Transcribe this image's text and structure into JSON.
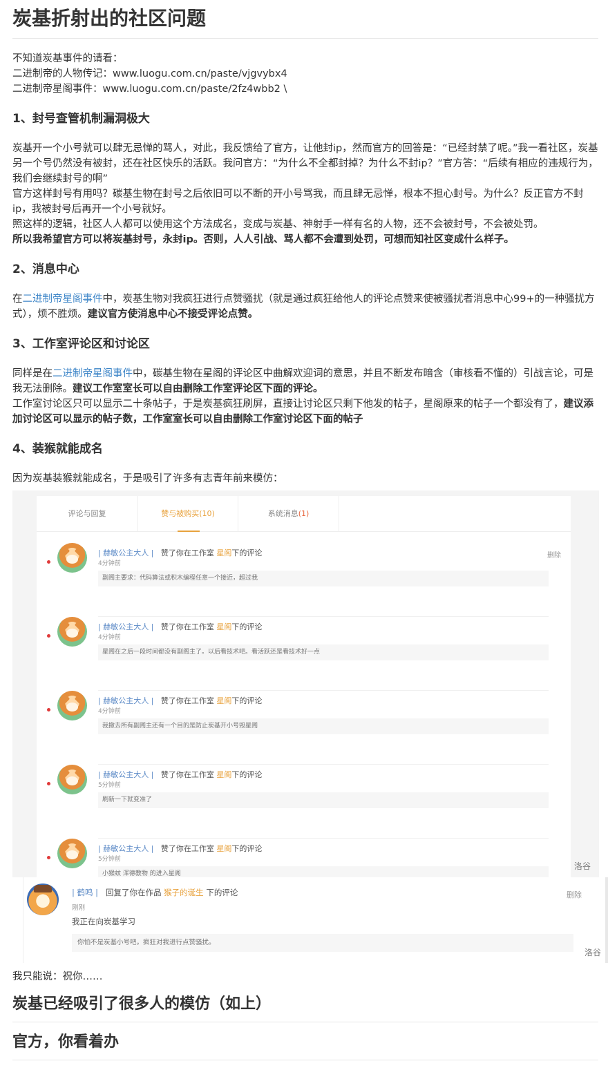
{
  "title": "炭基折射出的社区问题",
  "intro": [
    "不知道炭基事件的请看：",
    "二进制帝的人物传记：www.luogu.com.cn/paste/vjgvybx4",
    "二进制帝星阁事件：www.luogu.com.cn/paste/2fz4wbb2 \\"
  ],
  "sec1": {
    "heading": "1、封号查管机制漏洞极大",
    "p1": "炭基开一个小号就可以肆无忌惮的骂人，对此，我反馈给了官方，让他封ip，然而官方的回答是：“已经封禁了呢。”我一看社区，炭基另一个号仍然没有被封，还在社区快乐的活跃。我问官方：“为什么不全都封掉？为什么不封ip？”官方答：“后续有相应的违规行为，我们会继续封号的啊”",
    "p2": "官方这样封号有用吗？碳基生物在封号之后依旧可以不断的开小号骂我，而且肆无忌惮，根本不担心封号。为什么？反正官方不封ip，我被封号后再开一个小号就好。",
    "p3": "照这样的逻辑，社区人人都可以使用这个方法成名，变成与炭基、神射手一样有名的人物，还不会被封号，不会被处罚。",
    "p4_bold": "所以我希望官方可以将炭基封号，永封ip。否则，人人引战、骂人都不会遭到处罚，可想而知社区变成什么样子。"
  },
  "sec2": {
    "heading": "2、消息中心",
    "pre": "在",
    "link": "二进制帝星阁事件",
    "mid": "中，炭基生物对我疯狂进行点赞骚扰（就是通过疯狂给他人的评论点赞来使被骚扰者消息中心99+的一种骚扰方式），烦不胜烦。",
    "bold": "建议官方使消息中心不接受评论点赞。"
  },
  "sec3": {
    "heading": "3、工作室评论区和讨论区",
    "pre": "同样是在",
    "link": "二进制帝星阁事件",
    "mid": "中，碳基生物在星阁的评论区中曲解欢迎词的意思，并且不断发布暗含（审核看不懂的）引战言论，可是我无法删除。",
    "bold1": "建议工作室室长可以自由删除工作室评论区下面的评论。",
    "p2": "工作室讨论区只可以显示二十条帖子，于是炭基疯狂刷屏，直接让讨论区只剩下他发的帖子，星阁原来的帖子一个都没有了，",
    "bold2": "建议添加讨论区可以显示的帖子数，工作室室长可以自由删除工作室讨论区下面的帖子"
  },
  "sec4": {
    "heading": "4、装猴就能成名",
    "p1": "因为炭基装猴就能成名，于是吸引了许多有志青年前来模仿："
  },
  "shot1": {
    "tabs": [
      {
        "label": "评论与回复",
        "count": ""
      },
      {
        "label": "赞与被购买",
        "count": "(10)"
      },
      {
        "label": "系统消息",
        "count": "(1)"
      }
    ],
    "notices": [
      {
        "user": "| 赫敏公主大人 |",
        "action": "赞了你在工作室",
        "target": "星阁",
        "suffix": "下的评论",
        "time": "4分钟前",
        "delete": "删除",
        "quote": "副阁主要求：代码算法或积木编程任意一个接近，超过我"
      },
      {
        "user": "| 赫敏公主大人 |",
        "action": "赞了你在工作室",
        "target": "星阁",
        "suffix": "下的评论",
        "time": "4分钟前",
        "delete": "",
        "quote": "星阁在之后一段时间都没有副阁主了。以后看技术吧。看活跃还是看技术好一点"
      },
      {
        "user": "| 赫敏公主大人 |",
        "action": "赞了你在工作室",
        "target": "星阁",
        "suffix": "下的评论",
        "time": "4分钟前",
        "delete": "",
        "quote": "我撤去所有副阁主还有一个目的是防止炭基开小号毁星阁"
      },
      {
        "user": "| 赫敏公主大人 |",
        "action": "赞了你在工作室",
        "target": "星阁",
        "suffix": "下的评论",
        "time": "5分钟前",
        "delete": "",
        "quote": "刷新一下就变准了"
      },
      {
        "user": "| 赫敏公主大人 |",
        "action": "赞了你在工作室",
        "target": "星阁",
        "suffix": "下的评论",
        "time": "5分钟前",
        "delete": "",
        "quote": "小猴蚊 浑德教物 的进入星阁"
      }
    ],
    "watermark": "洛谷"
  },
  "shot2": {
    "user": "| 鹤鸣 |",
    "action": "回复了你在作品",
    "work": "猴子的诞生",
    "suffix": "下的评论",
    "time": "刚刚",
    "reply": "我正在向炭基学习",
    "delete": "删除",
    "quote": "你怕不是炭基小号吧，疯狂对我进行点赞骚扰。",
    "watermark": "洛谷"
  },
  "after": "我只能说：祝你……",
  "heading_big1": "炭基已经吸引了很多人的模仿（如上）",
  "heading_big2": "官方，你看着办"
}
